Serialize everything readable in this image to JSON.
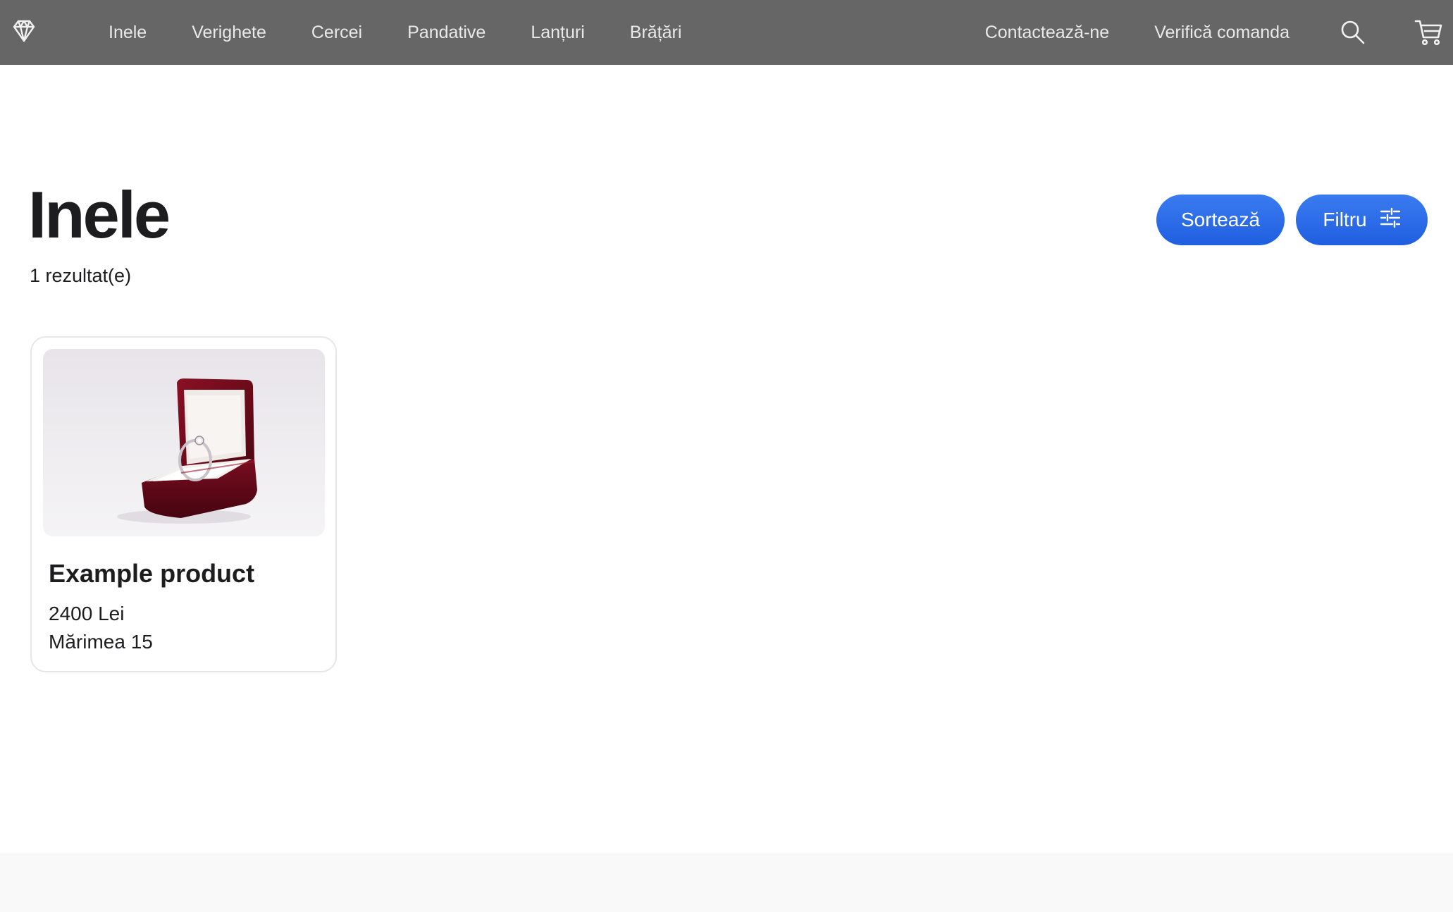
{
  "nav": {
    "left_items": [
      {
        "label": "Inele"
      },
      {
        "label": "Verighete"
      },
      {
        "label": "Cercei"
      },
      {
        "label": "Pandative"
      },
      {
        "label": "Lanțuri"
      },
      {
        "label": "Brățări"
      }
    ],
    "contact_label": "Contactează-ne",
    "check_order_label": "Verifică comanda",
    "icons": {
      "logo": "diamond-icon",
      "search": "search-icon",
      "cart": "cart-icon"
    }
  },
  "page": {
    "title": "Inele",
    "result_count": "1 rezultat(e)"
  },
  "actions": {
    "sort_label": "Sortează",
    "filter_label": "Filtru",
    "filter_icon": "sliders-icon"
  },
  "products": [
    {
      "name": "Example product",
      "price": "2400 Lei",
      "size": "Mărimea 15",
      "image": "ring-box-image"
    }
  ],
  "colors": {
    "topbar": "#666666",
    "accent": "#2a68e8",
    "footer": "#f9f9f9"
  }
}
